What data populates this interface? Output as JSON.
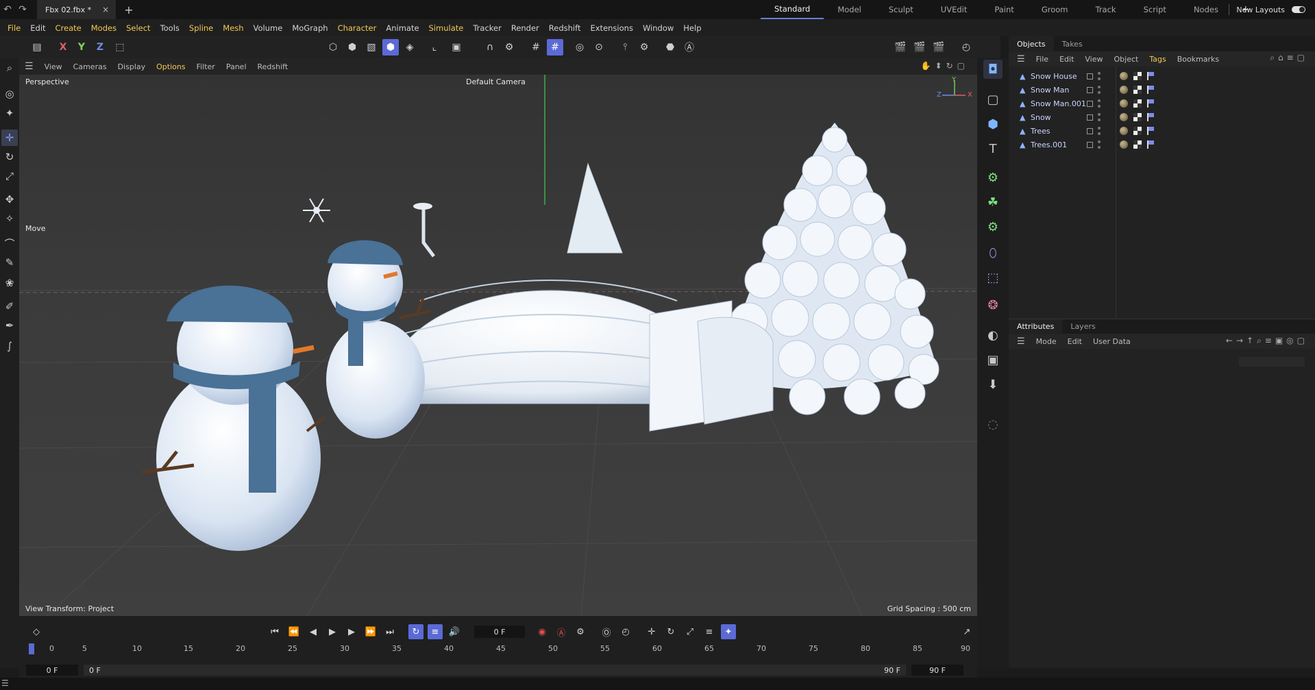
{
  "titlebar": {
    "doc_tab": "Fbx 02.fbx *",
    "close_glyph": "×",
    "layouts": [
      "Standard",
      "Model",
      "Sculpt",
      "UVEdit",
      "Paint",
      "Groom",
      "Track",
      "Script",
      "Nodes"
    ],
    "active_layout": "Standard",
    "new_layouts_label": "New Layouts"
  },
  "menubar": {
    "items": [
      "File",
      "Edit",
      "Create",
      "Modes",
      "Select",
      "Tools",
      "Spline",
      "Mesh",
      "Volume",
      "MoGraph",
      "Character",
      "Animate",
      "Simulate",
      "Tracker",
      "Render",
      "Redshift",
      "Extensions",
      "Window",
      "Help"
    ]
  },
  "toolbar": {
    "x": "X",
    "y": "Y",
    "z": "Z"
  },
  "viewport": {
    "menu": [
      "View",
      "Cameras",
      "Display",
      "Options",
      "Filter",
      "Panel",
      "Redshift"
    ],
    "projection": "Perspective",
    "camera": "Default Camera",
    "tool_label": "Move",
    "view_transform": "View Transform: Project",
    "grid_spacing": "Grid Spacing : 500 cm",
    "axis_y": "Y",
    "axis_x": "X",
    "axis_z": "Z"
  },
  "timeline": {
    "current_frame": "0 F",
    "start_field": "0 F",
    "start_field2": "0 F",
    "end_field": "90 F",
    "end_field2": "90 F",
    "ruler": [
      "0",
      "5",
      "10",
      "15",
      "20",
      "25",
      "30",
      "35",
      "40",
      "45",
      "50",
      "55",
      "60",
      "65",
      "70",
      "75",
      "80",
      "85",
      "90"
    ]
  },
  "objects_panel": {
    "tabs": [
      "Objects",
      "Takes"
    ],
    "menu": [
      "File",
      "Edit",
      "View",
      "Object",
      "Tags",
      "Bookmarks"
    ],
    "items": [
      "Snow House",
      "Snow Man",
      "Snow Man.001",
      "Snow",
      "Trees",
      "Trees.001"
    ]
  },
  "attributes_panel": {
    "tabs": [
      "Attributes",
      "Layers"
    ],
    "menu": [
      "Mode",
      "Edit",
      "User Data"
    ]
  },
  "colors": {
    "accent": "#5b6ad6",
    "highlight_text": "#f2c955",
    "timeline_axis": "#3fae4a"
  }
}
